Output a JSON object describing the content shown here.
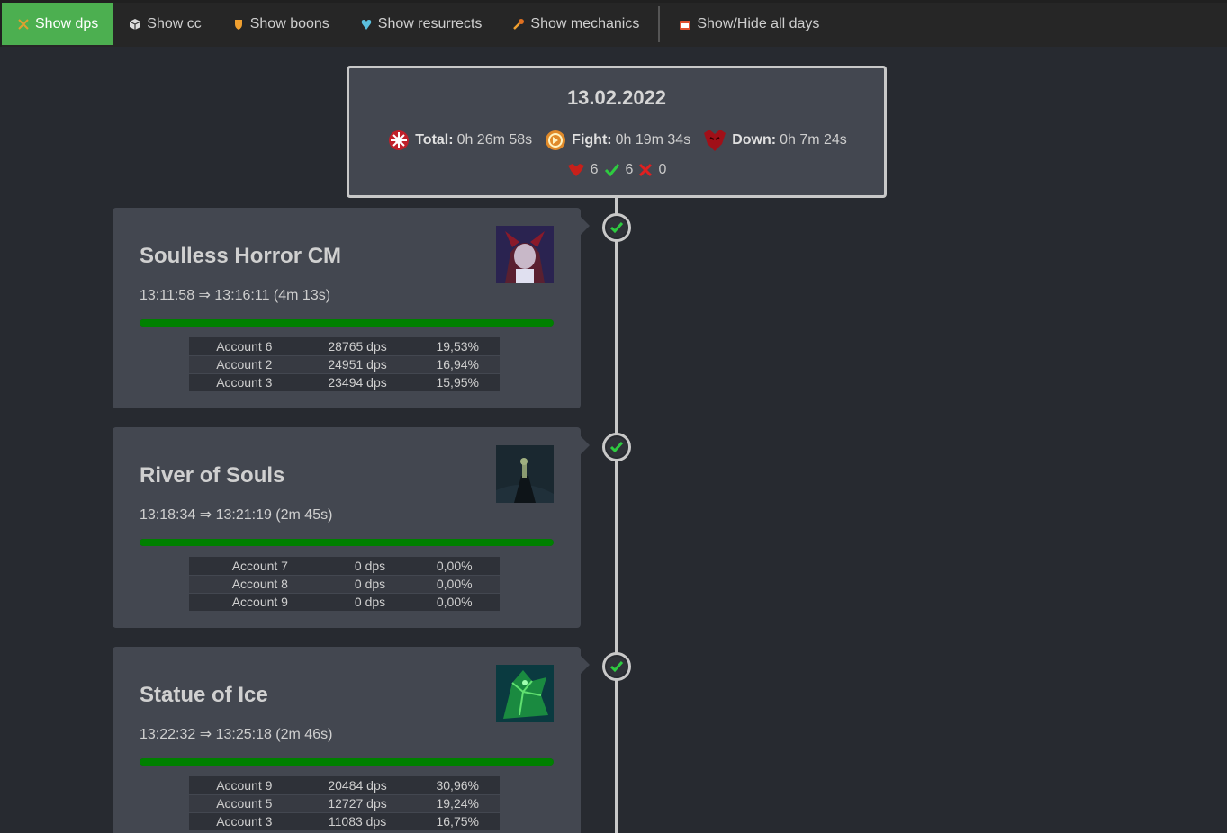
{
  "toolbar": {
    "buttons": [
      {
        "label": "Show dps",
        "icon": "crossed-swords-icon",
        "active": true
      },
      {
        "label": "Show cc",
        "icon": "cube-icon",
        "active": false
      },
      {
        "label": "Show boons",
        "icon": "shield-icon",
        "active": false
      },
      {
        "label": "Show resurrects",
        "icon": "heart-icon",
        "active": false
      },
      {
        "label": "Show mechanics",
        "icon": "wrench-icon",
        "active": false
      },
      {
        "label": "Show/Hide all days",
        "icon": "calendar-icon",
        "active": false
      }
    ]
  },
  "day": {
    "date": "13.02.2022",
    "total_label": "Total:",
    "total_value": "0h 26m 58s",
    "fight_label": "Fight:",
    "fight_value": "0h 19m 34s",
    "down_label": "Down:",
    "down_value": "0h 7m 24s",
    "count_total": "6",
    "count_success": "6",
    "count_fail": "0"
  },
  "fights": [
    {
      "name": "Soulless Horror CM",
      "time": "13:11:58 ⇒ 13:16:11 (4m 13s)",
      "progress": 1.0,
      "success": true,
      "rows": [
        {
          "account": "Account 6",
          "dps": "28765 dps",
          "pct": "19,53%"
        },
        {
          "account": "Account 2",
          "dps": "24951 dps",
          "pct": "16,94%"
        },
        {
          "account": "Account 3",
          "dps": "23494 dps",
          "pct": "15,95%"
        }
      ]
    },
    {
      "name": "River of Souls",
      "time": "13:18:34 ⇒ 13:21:19 (2m 45s)",
      "progress": 1.0,
      "success": true,
      "rows": [
        {
          "account": "Account 7",
          "dps": "0 dps",
          "pct": "0,00%"
        },
        {
          "account": "Account 8",
          "dps": "0 dps",
          "pct": "0,00%"
        },
        {
          "account": "Account 9",
          "dps": "0 dps",
          "pct": "0,00%"
        }
      ]
    },
    {
      "name": "Statue of Ice",
      "time": "13:22:32 ⇒ 13:25:18 (2m 46s)",
      "progress": 1.0,
      "success": true,
      "rows": [
        {
          "account": "Account 9",
          "dps": "20484 dps",
          "pct": "30,96%"
        },
        {
          "account": "Account 5",
          "dps": "12727 dps",
          "pct": "19,24%"
        },
        {
          "account": "Account 3",
          "dps": "11083 dps",
          "pct": "16,75%"
        }
      ]
    }
  ],
  "colors": {
    "active_button": "#4caf50",
    "progress": "#008000",
    "success": "#2ecc40",
    "fail": "#e02020"
  }
}
